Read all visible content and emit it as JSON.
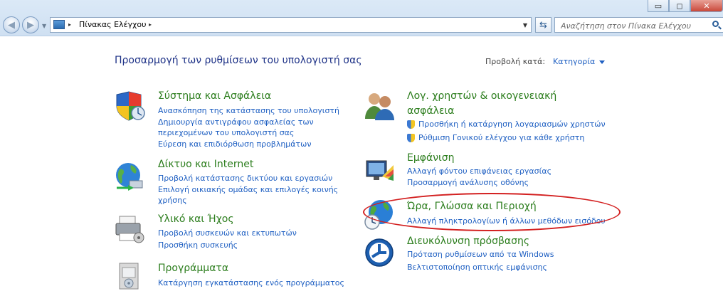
{
  "window": {
    "minimize_glyph": "▭",
    "maximize_glyph": "◻",
    "close_glyph": "✕"
  },
  "address_bar": {
    "path": "Πίνακας Ελέγχου",
    "separator": "▸"
  },
  "search": {
    "placeholder": "Αναζήτηση στον Πίνακα Ελέγχου"
  },
  "header": {
    "title": "Προσαρμογή των ρυθμίσεων του υπολογιστή σας",
    "view_by_label": "Προβολή κατά:",
    "view_by_value": "Κατηγορία"
  },
  "categories": {
    "system": {
      "title": "Σύστημα και Ασφάλεια",
      "links": [
        "Ανασκόπηση της κατάστασης του υπολογιστή",
        "Δημιουργία αντιγράφου ασφαλείας των",
        "περιεχομένων του υπολογιστή σας",
        "Εύρεση και επιδιόρθωση προβλημάτων"
      ]
    },
    "network": {
      "title": "Δίκτυο και Internet",
      "links": [
        "Προβολή κατάστασης δικτύου και εργασιών",
        "Επιλογή οικιακής ομάδας και επιλογές κοινής",
        "χρήσης"
      ]
    },
    "hardware": {
      "title": "Υλικό και Ήχος",
      "links": [
        "Προβολή συσκευών και εκτυπωτών",
        "Προσθήκη συσκευής"
      ]
    },
    "programs": {
      "title": "Προγράμματα",
      "links": [
        "Κατάργηση εγκατάστασης ενός προγράμματος"
      ]
    },
    "accounts": {
      "title_line1": "Λογ. χρηστών & οικογενειακή",
      "title_line2": "ασφάλεια",
      "links": [
        "Προσθήκη ή κατάργηση λογαριασμών χρηστών",
        "Ρύθμιση Γονικού ελέγχου για κάθε χρήστη"
      ]
    },
    "appearance": {
      "title": "Εμφάνιση",
      "links": [
        "Αλλαγή φόντου επιφάνειας εργασίας",
        "Προσαρμογή ανάλυσης οθόνης"
      ]
    },
    "clock": {
      "title": "Ώρα, Γλώσσα και Περιοχή",
      "links": [
        "Αλλαγή πληκτρολογίων ή άλλων μεθόδων εισόδου"
      ]
    },
    "ease": {
      "title": "Διευκόλυνση πρόσβασης",
      "links": [
        "Πρόταση ρυθμίσεων από τα Windows",
        "Βελτιστοποίηση οπτικής εμφάνισης"
      ]
    }
  },
  "colors": {
    "category_title": "#2b7d1c",
    "link": "#1e5fc2",
    "annotation": "#d32020"
  }
}
